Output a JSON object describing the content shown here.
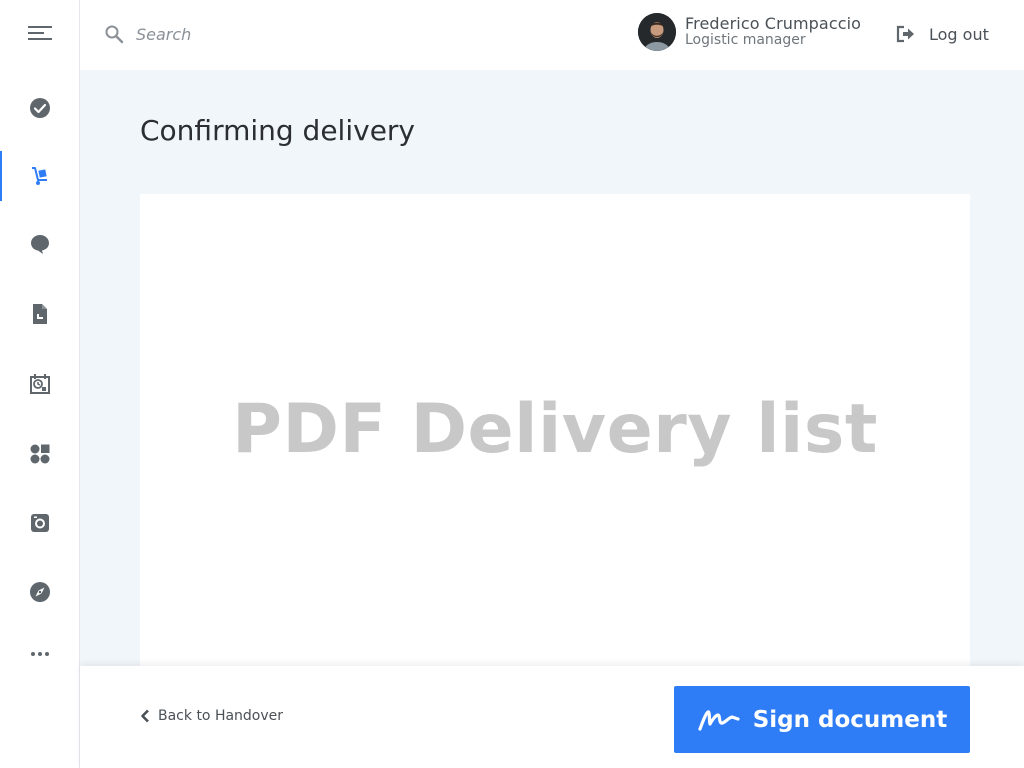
{
  "colors": {
    "accent": "#2f7df6",
    "icon": "#5f676d",
    "panel_bg": "#f1f6fa"
  },
  "sidebar": {
    "items": [
      {
        "icon": "menu-icon"
      },
      {
        "icon": "check-circle-icon"
      },
      {
        "icon": "hand-truck-icon",
        "active": true
      },
      {
        "icon": "chat-bubble-icon"
      },
      {
        "icon": "document-icon"
      },
      {
        "icon": "calendar-clock-icon"
      },
      {
        "icon": "apps-grid-icon"
      },
      {
        "icon": "camera-icon"
      },
      {
        "icon": "compass-icon"
      },
      {
        "icon": "more-dots-icon"
      }
    ]
  },
  "header": {
    "search_placeholder": "Search",
    "user": {
      "name": "Frederico Crumpaccio",
      "role": "Logistic manager"
    },
    "logout_label": "Log out"
  },
  "main": {
    "title": "Confirming delivery",
    "pdf_placeholder": "PDF Delivery list"
  },
  "footer": {
    "back_label": "Back to Handover",
    "sign_label": "Sign document"
  }
}
